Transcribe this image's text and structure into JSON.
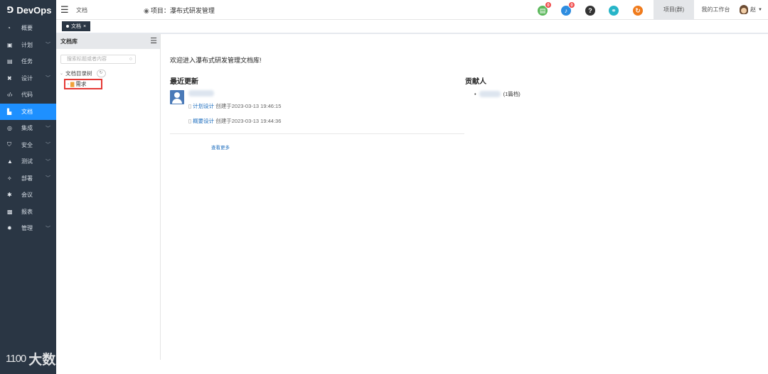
{
  "sidebar": {
    "brand": "DevOps",
    "brand_icon": "devops-logo-icon",
    "items": [
      {
        "icon": "dashboard-icon",
        "label": "概要",
        "has_arrow": false
      },
      {
        "icon": "plan-icon",
        "label": "计划",
        "has_arrow": true
      },
      {
        "icon": "task-icon",
        "label": "任务",
        "has_arrow": false
      },
      {
        "icon": "design-icon",
        "label": "设计",
        "has_arrow": true
      },
      {
        "icon": "code-icon",
        "label": "代码",
        "has_arrow": false
      },
      {
        "icon": "document-icon",
        "label": "文档",
        "has_arrow": false,
        "active": true
      },
      {
        "icon": "integration-icon",
        "label": "集成",
        "has_arrow": true
      },
      {
        "icon": "security-icon",
        "label": "安全",
        "has_arrow": true
      },
      {
        "icon": "test-icon",
        "label": "测试",
        "has_arrow": true
      },
      {
        "icon": "deploy-icon",
        "label": "部署",
        "has_arrow": true
      },
      {
        "icon": "meeting-icon",
        "label": "会议",
        "has_arrow": false
      },
      {
        "icon": "report-icon",
        "label": "报表",
        "has_arrow": false
      },
      {
        "icon": "admin-icon",
        "label": "管理",
        "has_arrow": true
      }
    ]
  },
  "topbar": {
    "crumb": "文档",
    "project_label": "项目：瀑布式研发管理",
    "icons": [
      {
        "name": "notes-icon",
        "color": "#5cb85c",
        "badge": "0"
      },
      {
        "name": "bell-icon",
        "color": "#2e8de0",
        "badge": "0"
      },
      {
        "name": "help-icon",
        "color": "#333333",
        "badge": ""
      },
      {
        "name": "link-icon",
        "color": "#27b5c8",
        "badge": ""
      },
      {
        "name": "share-icon",
        "color": "#f07b1c",
        "badge": ""
      }
    ],
    "tabs": {
      "project": "项目(群)",
      "workspace": "我的工作台"
    },
    "user": "赵"
  },
  "page_tab": {
    "label": "文档",
    "close": "×"
  },
  "doc_panel": {
    "title": "文档库",
    "search_placeholder": "搜索标题或者内容",
    "tree_root": "文档目录树",
    "tree_node": "需求"
  },
  "main": {
    "welcome": "欢迎进入瀑布式研发管理文档库!",
    "recent_title": "最近更新",
    "updates": [
      {
        "doc": "计划设计",
        "text": "创建于2023-03-13 19:46:15"
      },
      {
        "doc": "概要设计",
        "text": "创建于2023-03-13 19:44:36"
      }
    ],
    "see_more": "查看更多",
    "contrib_title": "贡献人",
    "contributor_note": "(1篇档)"
  },
  "watermark": {
    "logo": "1100",
    "text": "大数跨境"
  }
}
